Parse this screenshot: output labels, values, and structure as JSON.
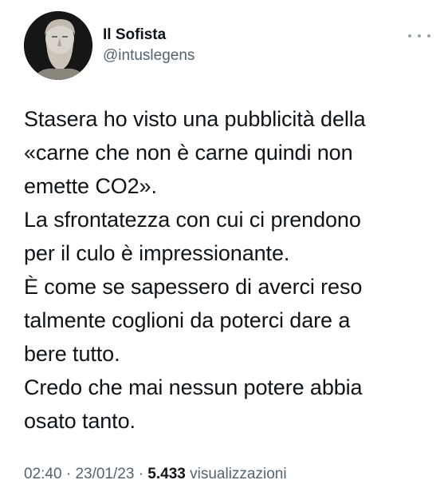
{
  "author": {
    "display_name": "Il Sofista",
    "handle": "@intuslegens",
    "avatar_icon": "philosopher-bust-avatar"
  },
  "tweet": {
    "lines": [
      "Stasera ho visto una pubblicità della",
      "«carne che non è carne quindi non",
      "emette CO2».",
      "La sfrontatezza con cui ci prendono",
      "per il culo è impressionante.",
      "È come se sapessero di averci reso",
      "talmente coglioni da poterci dare a",
      "bere tutto.",
      "Credo che mai nessun potere abbia",
      "osato tanto."
    ]
  },
  "meta": {
    "time": "02:40",
    "separator": "·",
    "date": "23/01/23",
    "views_count": "5.433",
    "views_label": "visualizzazioni"
  },
  "icons": {
    "more": "more-horizontal-icon"
  },
  "colors": {
    "text_primary": "#0f1419",
    "text_secondary": "#536471",
    "background": "#ffffff"
  }
}
